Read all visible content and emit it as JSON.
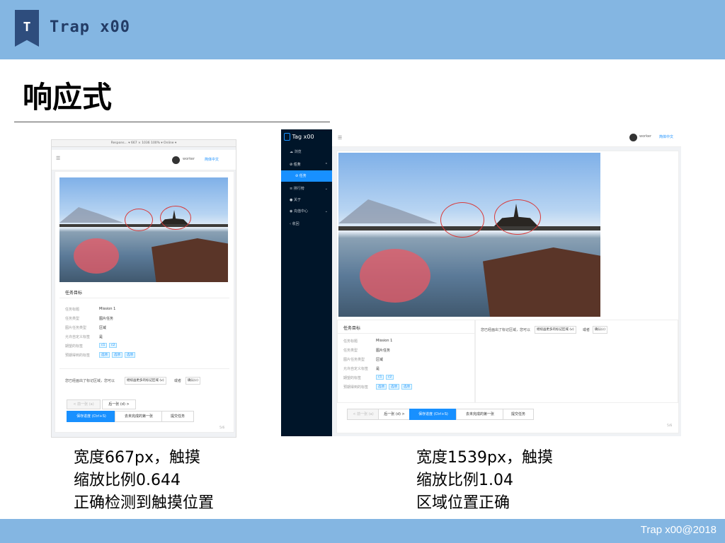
{
  "slide": {
    "logo_letter": "T",
    "brand": "Trap x00",
    "title": "响应式",
    "footer": "Trap x00@2018"
  },
  "left_screen": {
    "device_toolbar": "Respons... ▾   667  ×  1036   100% ▾   Online ▾",
    "user": "worker",
    "language": "简体中文",
    "section_title": "任务目标",
    "rows": [
      {
        "label": "任务标题",
        "value": "Mission 1"
      },
      {
        "label": "任务类型",
        "value": "图片任务"
      },
      {
        "label": "图片任务类型",
        "value": "区域"
      },
      {
        "label": "允许自定义标签",
        "value": "是"
      },
      {
        "label": "期望的标签",
        "tags": [
          "c1",
          "c2"
        ]
      },
      {
        "label": "预期得到的标签",
        "tags": [
          "选项",
          "选项",
          "选项"
        ]
      }
    ],
    "hint_text": "您已经画出了标记区域，您可以",
    "hint_button": "继续画更多的标记区域 (v)",
    "hint_or": "或者",
    "hint_confirm": "确认(c)",
    "prev_button": "< 前一张 (a)",
    "next_button": "后一张 (d) >",
    "save_button": "保存进度 (Ctrl+S)",
    "goto_button": "去未完成的第一张",
    "submit_button": "提交任务",
    "progress": "5/6"
  },
  "right_screen": {
    "app_name": "Tag x00",
    "menu": [
      {
        "label": "浏览"
      },
      {
        "label": "任务"
      },
      {
        "label": "任务",
        "sub": true
      },
      {
        "label": "排行榜"
      },
      {
        "label": "关于"
      },
      {
        "label": "充值中心"
      },
      {
        "label": "收回"
      }
    ],
    "user": "worker",
    "language": "简体中文",
    "section_title": "任务目标",
    "rows": [
      {
        "label": "任务标题",
        "value": "Mission 1"
      },
      {
        "label": "任务类型",
        "value": "图片任务"
      },
      {
        "label": "图片任务类型",
        "value": "区域"
      },
      {
        "label": "允许自定义标签",
        "value": "是"
      },
      {
        "label": "期望的标签",
        "tags": [
          "c1",
          "c2"
        ]
      },
      {
        "label": "预期得到的标签",
        "tags": [
          "选项",
          "选项",
          "选项"
        ]
      }
    ],
    "hint_text": "您已经画出了标记区域，您可以",
    "hint_button": "继续画更多的标记区域 (v)",
    "hint_or": "或者",
    "hint_confirm": "确认(c)",
    "prev_button": "< 前一张 (a)",
    "next_button": "后一张 (d) >",
    "save_button": "保存进度 (Ctrl+S)",
    "goto_button": "去未完成的第一张",
    "submit_button": "提交任务",
    "progress": "5/6"
  },
  "captions": {
    "left": [
      "宽度667px，触摸",
      "缩放比例0.644",
      "正确检测到触摸位置"
    ],
    "right": [
      "宽度1539px，触摸",
      "缩放比例1.04",
      "区域位置正确"
    ]
  }
}
